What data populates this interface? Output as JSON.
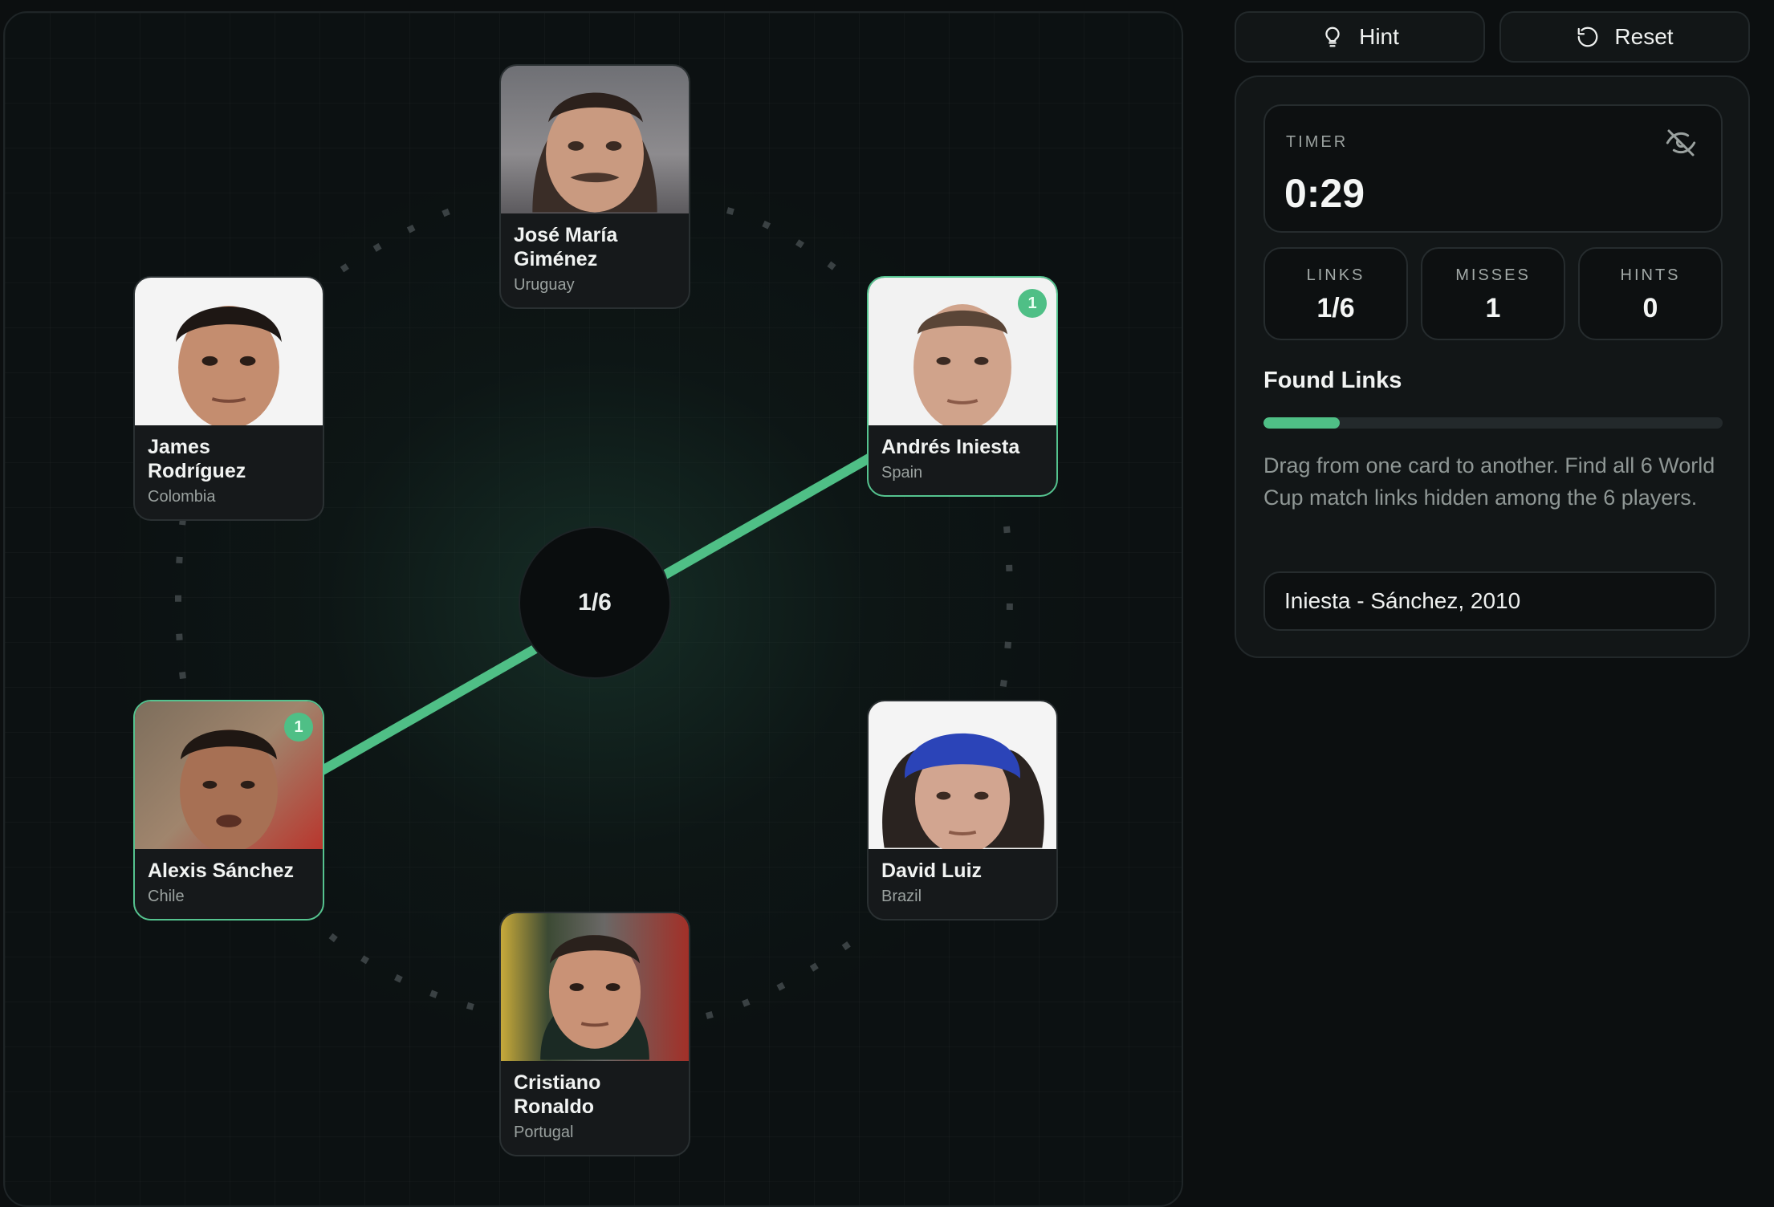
{
  "board": {
    "center_progress": "1/6",
    "players": [
      {
        "id": "gimenez",
        "name_line1": "José María",
        "name_line2": "Giménez",
        "country": "Uruguay",
        "found_count": null
      },
      {
        "id": "rodriguez",
        "name_line1": "James Rodríguez",
        "name_line2": "",
        "country": "Colombia",
        "found_count": null
      },
      {
        "id": "iniesta",
        "name_line1": "Andrés Iniesta",
        "name_line2": "",
        "country": "Spain",
        "found_count": "1"
      },
      {
        "id": "sanchez",
        "name_line1": "Alexis Sánchez",
        "name_line2": "",
        "country": "Chile",
        "found_count": "1"
      },
      {
        "id": "luiz",
        "name_line1": "David Luiz",
        "name_line2": "",
        "country": "Brazil",
        "found_count": null
      },
      {
        "id": "ronaldo",
        "name_line1": "Cristiano",
        "name_line2": "Ronaldo",
        "country": "Portugal",
        "found_count": null
      }
    ],
    "found_link": {
      "from": "sanchez",
      "to": "iniesta",
      "color": "#4fbf86"
    }
  },
  "toolbar": {
    "hint_label": "Hint",
    "hint_icon": "lightbulb-icon",
    "reset_label": "Reset",
    "reset_icon": "reset-icon"
  },
  "panel": {
    "timer_label": "TIMER",
    "timer_value": "0:29",
    "timer_toggle_icon": "eye-off-icon",
    "stats": {
      "links_label": "LINKS",
      "links_value": "1/6",
      "misses_label": "MISSES",
      "misses_value": "1",
      "hints_label": "HINTS",
      "hints_value": "0"
    },
    "found_title": "Found Links",
    "progress_fraction": 0.1667,
    "instructions": "Drag from one card to another. Find all 6 World Cup match links hidden among the 6 players.",
    "found_links": [
      "Iniesta - Sánchez, 2010"
    ]
  },
  "colors": {
    "accent": "#4fbf86",
    "background": "#0c0f10",
    "card": "#16191b"
  }
}
